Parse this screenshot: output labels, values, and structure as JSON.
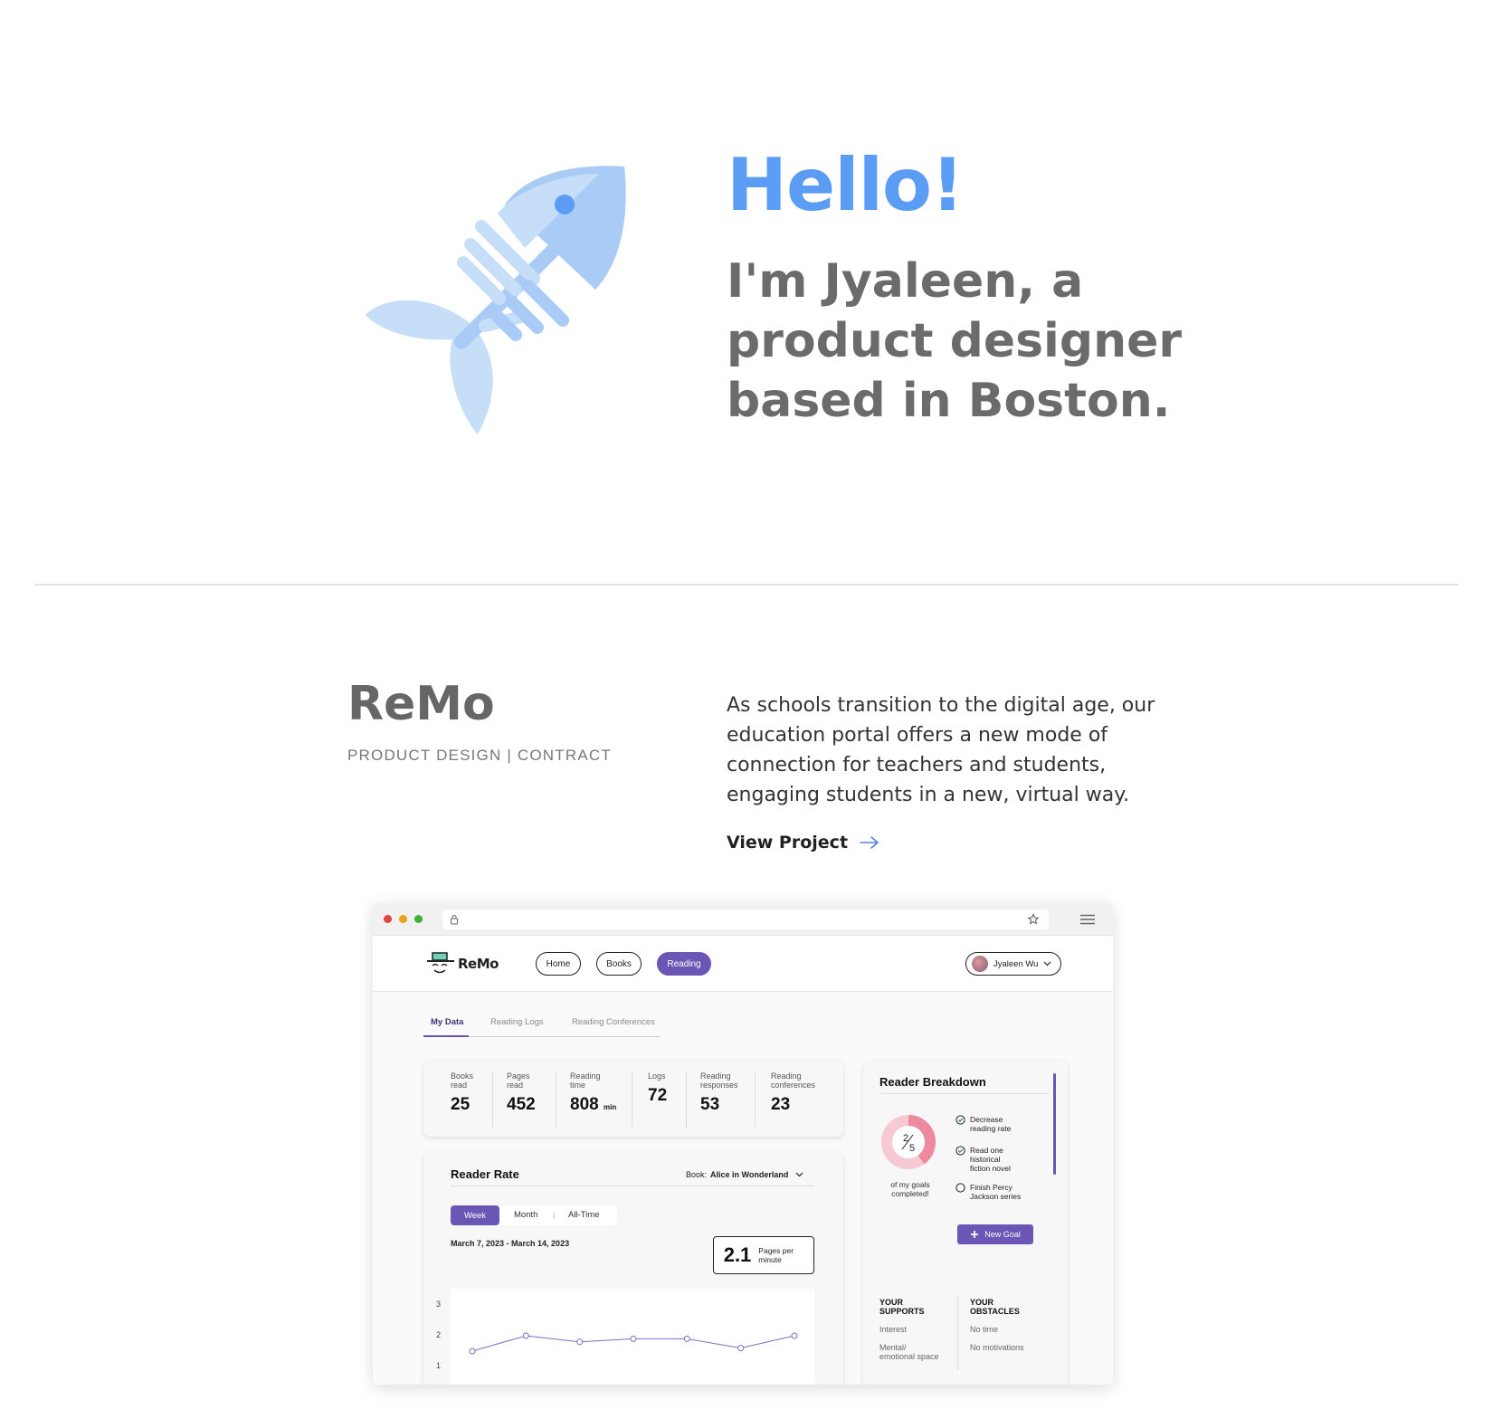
{
  "hero": {
    "greeting": "Hello!",
    "intro": "I'm Jyaleen, a product designer based in Boston.",
    "logo_icon": "fish-bone-icon",
    "accent_color": "#5b9cf5"
  },
  "project": {
    "title": "ReMo",
    "tags": "PRODUCT DESIGN | CONTRACT",
    "description": "As schools transition to the digital age, our education portal offers a new mode of connection for teachers and students, engaging students in a new, virtual way.",
    "link_label": "View Project"
  },
  "mockup": {
    "brand": "ReMo",
    "nav": {
      "home": "Home",
      "books": "Books",
      "reading": "Reading"
    },
    "user_name": "Jyaleen Wu",
    "tabs": {
      "my_data": "My Data",
      "reading_logs": "Reading Logs",
      "conferences": "Reading Conferences"
    },
    "stats": [
      {
        "label": "Books read",
        "value": "25"
      },
      {
        "label": "Pages read",
        "value": "452"
      },
      {
        "label": "Reading time",
        "value": "808",
        "unit": "min"
      },
      {
        "label": "Logs",
        "value": "72"
      },
      {
        "label": "Reading responses",
        "value": "53"
      },
      {
        "label": "Reading conferences",
        "value": "23"
      }
    ],
    "reader_rate": {
      "title": "Reader Rate",
      "book_label": "Book:",
      "book_value": "Alice in Wonderland",
      "periods": {
        "week": "Week",
        "month": "Month",
        "all": "All-Time"
      },
      "date_range": "March 7, 2023 - March 14, 2023",
      "ppm_value": "2.1",
      "ppm_unit": "Pages per minute"
    },
    "breakdown": {
      "title": "Reader Breakdown",
      "donut_num": "2",
      "donut_den": "5",
      "donut_caption": "of my goals completed!",
      "goals": [
        {
          "text": "Decrease reading rate",
          "done": true
        },
        {
          "text": "Read one historical fiction novel",
          "done": true
        },
        {
          "text": "Finish Percy Jackson series",
          "done": false
        }
      ],
      "new_goal": "New Goal",
      "supports_title": "YOUR SUPPORTS",
      "supports": [
        "Interest",
        "Mental/ emotional space"
      ],
      "obstacles_title": "YOUR OBSTACLES",
      "obstacles": [
        "No time",
        "No motivations"
      ]
    }
  },
  "chart_data": {
    "type": "line",
    "x": [
      1,
      2,
      3,
      4,
      5,
      6,
      7
    ],
    "values": [
      1.5,
      2.0,
      1.8,
      1.9,
      1.9,
      1.6,
      2.0
    ],
    "yticks": [
      "3",
      "2",
      "1"
    ],
    "ylim": [
      1,
      3
    ],
    "color": "#7a6fc0"
  }
}
